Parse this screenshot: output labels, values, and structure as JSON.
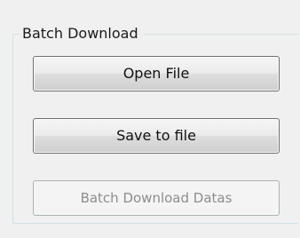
{
  "group": {
    "title": "Batch Download"
  },
  "buttons": {
    "open_file": "Open File",
    "save_to_file": "Save to file",
    "batch_download": "Batch Download Datas"
  }
}
